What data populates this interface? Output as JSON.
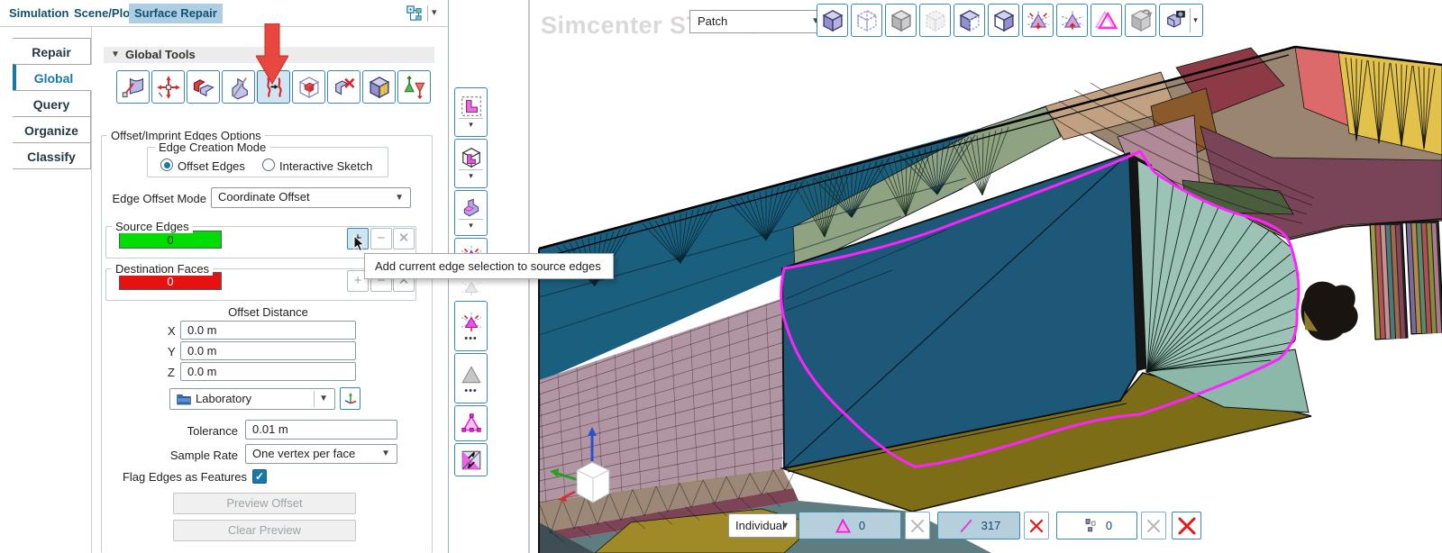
{
  "window": {
    "tabs": [
      "Simulation",
      "Scene/Plot",
      "Surface Repair"
    ],
    "active_tab": "Surface Repair",
    "tree_icon": "scene-hierarchy-icon"
  },
  "left_panel": {
    "side_tabs": [
      "Repair",
      "Global",
      "Query",
      "Organize",
      "Classify"
    ],
    "active_side_tab": "Global",
    "tools_header": "Global Tools",
    "tools": [
      "patch-faces",
      "transform",
      "fill-holes",
      "split-imprint",
      "offset-imprint-edges",
      "intersect-parts",
      "delete-intersecting",
      "offset-faces",
      "flip-face-normals"
    ],
    "active_tool": "offset-imprint-edges",
    "options": {
      "group_title": "Offset/Imprint Edges Options",
      "edge_creation_mode": {
        "label": "Edge Creation Mode",
        "options": [
          "Offset Edges",
          "Interactive Sketch"
        ],
        "selected": "Offset Edges"
      },
      "edge_offset_mode": {
        "label": "Edge Offset Mode",
        "value": "Coordinate Offset"
      },
      "source_edges": {
        "label": "Source Edges",
        "count": "0",
        "color": "#00dd00"
      },
      "destination_faces": {
        "label": "Destination Faces",
        "count": "0",
        "color": "#e81111"
      },
      "offset_distance": {
        "label": "Offset Distance",
        "x_label": "X",
        "x": "0.0 m",
        "y_label": "Y",
        "y": "0.0 m",
        "z_label": "Z",
        "z": "0.0 m"
      },
      "coordinate_system": {
        "value": "Laboratory"
      },
      "tolerance": {
        "label": "Tolerance",
        "value": "0.01 m"
      },
      "sample_rate": {
        "label": "Sample Rate",
        "value": "One vertex per face"
      },
      "flag_edges": {
        "label": "Flag Edges as Features",
        "checked": true
      },
      "buttons": [
        "Preview Offset",
        "Clear Preview"
      ]
    },
    "tooltip": "Add current edge selection to source edges"
  },
  "viewport": {
    "watermark": "Simcenter STAR-CCM+",
    "display_mode": {
      "value": "Patch"
    },
    "top_toolbar": [
      "cube-solid",
      "cube-transparent",
      "cube-gray",
      "cube-hidden",
      "cube-mixed",
      "cube-open",
      "selection-filter-down",
      "selection-filter-up",
      "highlight-triangle",
      "restore-view",
      "save-view-camera"
    ],
    "left_toolbar": [
      {
        "icon": "select-zone",
        "dropdown": true
      },
      {
        "icon": "select-through",
        "dropdown": true
      },
      {
        "icon": "select-part",
        "dropdown": true
      },
      {
        "icon": "grow-selection"
      },
      {
        "icon": "grow-selection-disabled",
        "disabled": true
      },
      {
        "icon": "shrink-selection",
        "ellipsis": true
      },
      {
        "icon": "selection-plain-disabled",
        "ellipsis": true
      },
      {
        "icon": "edit-selection"
      },
      {
        "icon": "invert-selection"
      }
    ],
    "bottom_bar": {
      "selection_mode": {
        "value": "Individual"
      },
      "faces_count": "0",
      "edges_count": "317",
      "vertices_count": "0"
    },
    "colors": {
      "selection_outline": "#ff22ff",
      "selected_face": "#1d5878"
    }
  },
  "colors": {
    "accent_blue": "#1878a8",
    "toolbar_border": "#3a8ab0",
    "active_tool_bg": "#cfe6f2",
    "active_tab_bg": "#aecfe3"
  }
}
